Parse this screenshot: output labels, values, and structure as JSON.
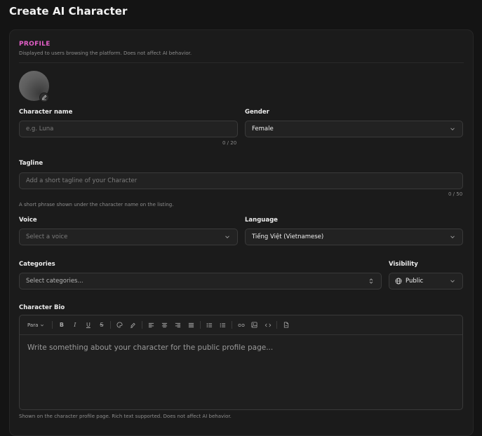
{
  "page": {
    "title": "Create AI Character"
  },
  "profile": {
    "section_label": "PROFILE",
    "section_desc": "Displayed to users browsing the platform. Does not affect AI behavior."
  },
  "character_name": {
    "label": "Character name",
    "placeholder": "e.g. Luna",
    "counter": "0 / 20"
  },
  "gender": {
    "label": "Gender",
    "value": "Female"
  },
  "tagline": {
    "label": "Tagline",
    "placeholder": "Add a short tagline of your Character",
    "counter": "0 / 50",
    "hint": "A short phrase shown under the character name on the listing."
  },
  "voice": {
    "label": "Voice",
    "placeholder": "Select a voice"
  },
  "language": {
    "label": "Language",
    "value": "Tiếng Việt (Vietnamese)"
  },
  "categories": {
    "label": "Categories",
    "placeholder": "Select categories..."
  },
  "visibility": {
    "label": "Visibility",
    "value": "Public"
  },
  "bio": {
    "label": "Character Bio",
    "toolbar_para": "Para",
    "placeholder": "Write something about your character for the public profile page...",
    "hint": "Shown on the character profile page. Rich text supported. Does not affect AI behavior."
  },
  "colors": {
    "accent": "#e35fc8",
    "background": "#141414",
    "card": "#1b1b1b"
  },
  "icons": [
    "pencil-icon",
    "chevron-down-icon",
    "chevron-updown-icon",
    "globe-icon",
    "bold-icon",
    "italic-icon",
    "underline-icon",
    "strikethrough-icon",
    "palette-icon",
    "highlighter-icon",
    "align-left-icon",
    "align-center-icon",
    "align-right-icon",
    "align-justify-icon",
    "bullet-list-icon",
    "ordered-list-icon",
    "link-icon",
    "image-icon",
    "code-icon",
    "file-icon"
  ]
}
